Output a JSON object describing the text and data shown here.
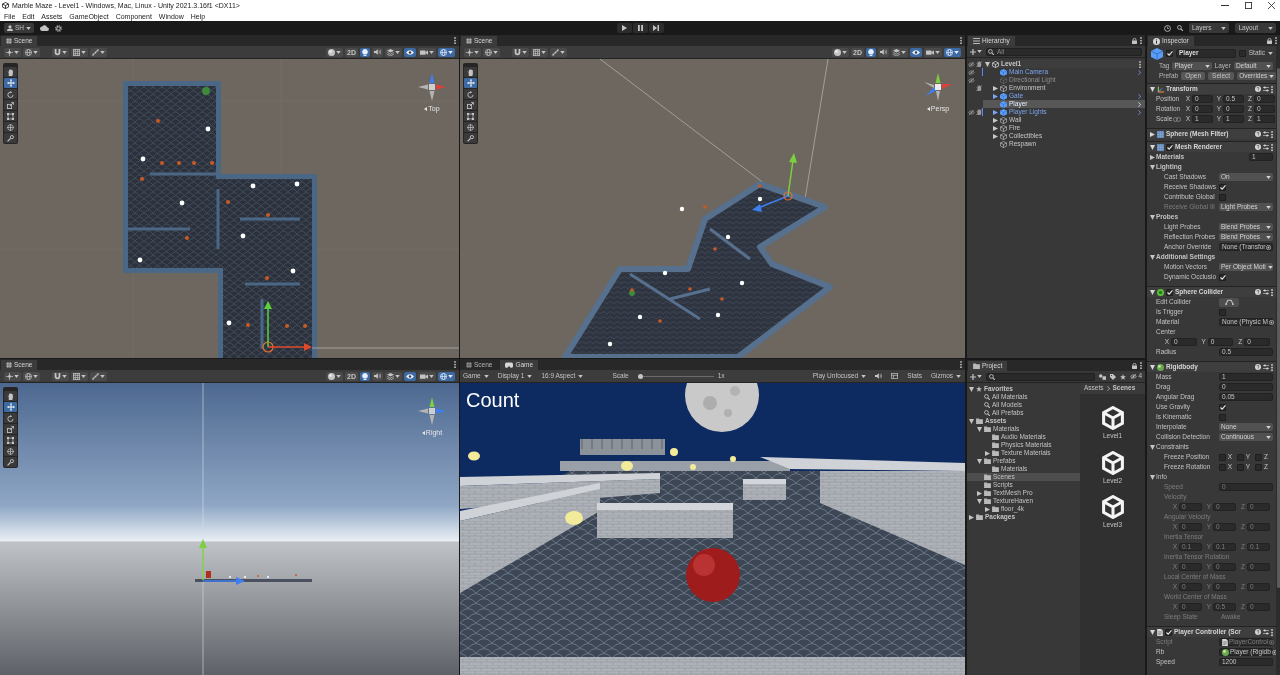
{
  "window": {
    "title": "Marble Maze - Level1 - Windows, Mac, Linux - Unity 2021.3.16f1 <DX11>"
  },
  "menu": [
    "File",
    "Edit",
    "Assets",
    "GameObject",
    "Component",
    "Window",
    "Help"
  ],
  "toolbar": {
    "account": "SH",
    "playing": false,
    "paused": false,
    "layers": "Layers",
    "layout": "Layout"
  },
  "scene_views": [
    {
      "kind": "top",
      "tabs": [
        {
          "label": "Scene",
          "kind": "scene",
          "selected": true
        }
      ],
      "tools": [
        {
          "kind": "hand",
          "selected": false
        },
        {
          "kind": "move",
          "selected": true
        },
        {
          "kind": "rotate",
          "selected": false
        },
        {
          "kind": "scale",
          "selected": false
        },
        {
          "kind": "rect",
          "selected": false
        },
        {
          "kind": "transform",
          "selected": false
        },
        {
          "kind": "custom",
          "selected": false
        }
      ],
      "two_d": {
        "label": "2D",
        "on": false
      },
      "lighting": true,
      "scene_visibility": true,
      "gizmos": true,
      "view_label": "Top"
    },
    {
      "kind": "perspective",
      "tabs": [
        {
          "label": "Scene",
          "kind": "scene",
          "selected": true
        }
      ],
      "tools": [
        {
          "kind": "hand",
          "selected": false
        },
        {
          "kind": "move",
          "selected": true
        },
        {
          "kind": "rotate",
          "selected": false
        },
        {
          "kind": "scale",
          "selected": false
        },
        {
          "kind": "rect",
          "selected": false
        },
        {
          "kind": "transform",
          "selected": false
        },
        {
          "kind": "custom",
          "selected": false
        }
      ],
      "two_d": {
        "label": "2D",
        "on": false
      },
      "lighting": true,
      "scene_visibility": true,
      "gizmos": true,
      "view_label": "Persp"
    },
    {
      "kind": "right",
      "tabs": [
        {
          "label": "Scene",
          "kind": "scene",
          "selected": true
        }
      ],
      "tools": [
        {
          "kind": "hand",
          "selected": false
        },
        {
          "kind": "move",
          "selected": true
        },
        {
          "kind": "rotate",
          "selected": false
        },
        {
          "kind": "scale",
          "selected": false
        },
        {
          "kind": "rect",
          "selected": false
        },
        {
          "kind": "transform",
          "selected": false
        },
        {
          "kind": "custom",
          "selected": false
        }
      ],
      "two_d": {
        "label": "2D",
        "on": false
      },
      "lighting": true,
      "scene_visibility": true,
      "gizmos": true,
      "view_label": "Right"
    }
  ],
  "game_panel": {
    "tabs": [
      {
        "label": "Scene",
        "kind": "scene",
        "selected": false
      },
      {
        "label": "Game",
        "kind": "game",
        "selected": true
      }
    ],
    "mode": "Game",
    "display": "Display 1",
    "aspect": "16:9 Aspect",
    "scale": {
      "label": "Scale",
      "level": 0,
      "reading": "1x"
    },
    "play_mode": "Play Unfocused",
    "muted": false,
    "stats": "Stats",
    "gizmos": "Gizmos",
    "hud_text": "Count"
  },
  "hierarchy": {
    "tabs": [
      {
        "label": "Hierarchy",
        "kind": "hierarchy",
        "selected": true
      }
    ],
    "search_placeholder": "All",
    "items": [
      {
        "label": "Level1",
        "kind": "scene",
        "expanded": true,
        "selected": false,
        "disabled": false,
        "hidden": true,
        "unpickable": true,
        "overridden": false,
        "children": [
          {
            "label": "Main Camera",
            "kind": "prefab",
            "selected": false,
            "disabled": false,
            "hidden": true,
            "unpickable": false,
            "overridden": true
          },
          {
            "label": "Directional Light",
            "kind": "object",
            "selected": false,
            "disabled": true,
            "hidden": true,
            "unpickable": false,
            "overridden": false
          },
          {
            "label": "Environment",
            "kind": "object",
            "expanded": false,
            "selected": false,
            "disabled": false,
            "hidden": false,
            "unpickable": true,
            "overridden": false
          },
          {
            "label": "Gate",
            "kind": "prefab",
            "expanded": false,
            "selected": false,
            "disabled": false,
            "hidden": false,
            "unpickable": false,
            "overridden": false
          },
          {
            "label": "Player",
            "kind": "prefab",
            "selected": true,
            "disabled": false,
            "hidden": false,
            "unpickable": false,
            "overridden": false
          },
          {
            "label": "Player Lights",
            "kind": "prefab",
            "expanded": false,
            "selected": false,
            "disabled": false,
            "hidden": true,
            "unpickable": true,
            "overridden": true
          },
          {
            "label": "Wall",
            "kind": "object",
            "expanded": false,
            "selected": false,
            "disabled": false,
            "hidden": false,
            "unpickable": false,
            "overridden": false
          },
          {
            "label": "Fire",
            "kind": "object",
            "expanded": false,
            "selected": false,
            "disabled": false,
            "hidden": false,
            "unpickable": false,
            "overridden": false
          },
          {
            "label": "Collectibles",
            "kind": "object",
            "expanded": false,
            "selected": false,
            "disabled": false,
            "hidden": false,
            "unpickable": false,
            "overridden": false
          },
          {
            "label": "Respawn",
            "kind": "object",
            "selected": false,
            "disabled": false,
            "hidden": false,
            "unpickable": false,
            "overridden": false
          }
        ]
      }
    ]
  },
  "project": {
    "tabs": [
      {
        "label": "Project",
        "kind": "project",
        "selected": true
      }
    ],
    "hidden_packages": "4",
    "tree": [
      {
        "label": "Favorites",
        "kind": "favorites",
        "expanded": true,
        "selected": false,
        "children": [
          {
            "label": "All Materials",
            "kind": "search",
            "selected": false
          },
          {
            "label": "All Models",
            "kind": "search",
            "selected": false
          },
          {
            "label": "All Prefabs",
            "kind": "search",
            "selected": false
          }
        ]
      },
      {
        "label": "Assets",
        "kind": "folder",
        "expanded": true,
        "selected": false,
        "children": [
          {
            "label": "Materials",
            "kind": "folder",
            "expanded": true,
            "selected": false,
            "children": [
              {
                "label": "Audio Materials",
                "kind": "folder",
                "selected": false
              },
              {
                "label": "Physics Materials",
                "kind": "folder",
                "selected": false
              },
              {
                "label": "Texture Materials",
                "kind": "folder",
                "expanded": false,
                "selected": false
              }
            ]
          },
          {
            "label": "Prefabs",
            "kind": "folder",
            "expanded": true,
            "selected": false,
            "children": [
              {
                "label": "Materials",
                "kind": "folder",
                "selected": false
              }
            ]
          },
          {
            "label": "Scenes",
            "kind": "folder",
            "selected": true
          },
          {
            "label": "Scripts",
            "kind": "folder",
            "selected": false
          },
          {
            "label": "TextMesh Pro",
            "kind": "folder",
            "expanded": false,
            "selected": false
          },
          {
            "label": "TextureHaven",
            "kind": "folder",
            "expanded": true,
            "selected": false,
            "children": [
              {
                "label": "floor_4k",
                "kind": "folder",
                "expanded": false,
                "selected": false
              }
            ]
          }
        ]
      },
      {
        "label": "Packages",
        "kind": "folder",
        "expanded": false,
        "selected": false
      }
    ],
    "breadcrumb": [
      "Assets",
      "Scenes"
    ],
    "assets": [
      {
        "label": "Level1",
        "kind": "scene"
      },
      {
        "label": "Level2",
        "kind": "scene"
      },
      {
        "label": "Level3",
        "kind": "scene"
      }
    ]
  },
  "inspector": {
    "tabs": [
      {
        "label": "Inspector",
        "kind": "inspector",
        "selected": true
      }
    ],
    "object": {
      "name": "Player",
      "active": true,
      "static_label": "Static",
      "static": false,
      "tag_label": "Tag",
      "tag": "Player",
      "layer_label": "Layer",
      "layer": "Default",
      "prefab_label": "Prefab",
      "prefab_buttons": [
        "Open",
        "Select"
      ],
      "overrides": "Overrides"
    },
    "components": [
      {
        "name": "Transform",
        "kind": "transform",
        "expanded": true,
        "rows": [
          {
            "kind": "vector",
            "label": "Position",
            "values": [
              {
                "axis": "X",
                "value": "0"
              },
              {
                "axis": "Y",
                "value": "0.5"
              },
              {
                "axis": "Z",
                "value": "0"
              }
            ]
          },
          {
            "kind": "vector",
            "label": "Rotation",
            "values": [
              {
                "axis": "X",
                "value": "0"
              },
              {
                "axis": "Y",
                "value": "0"
              },
              {
                "axis": "Z",
                "value": "0"
              }
            ]
          },
          {
            "kind": "vector",
            "label": "Scale",
            "linked": false,
            "values": [
              {
                "axis": "X",
                "value": "1"
              },
              {
                "axis": "Y",
                "value": "1"
              },
              {
                "axis": "Z",
                "value": "1"
              }
            ]
          }
        ]
      },
      {
        "name": "Sphere (Mesh Filter)",
        "kind": "mesh_filter",
        "expanded": false
      },
      {
        "name": "Mesh Renderer",
        "kind": "mesh_renderer",
        "enabled": true,
        "expanded": true,
        "rows": [
          {
            "kind": "section",
            "label": "Materials",
            "expanded": false,
            "count": "1"
          },
          {
            "kind": "section",
            "label": "Lighting",
            "expanded": true,
            "rows": [
              {
                "kind": "dropdown",
                "label": "Cast Shadows",
                "value": "On",
                "disabled": false
              },
              {
                "kind": "checkbox",
                "label": "Receive Shadows",
                "checked": true,
                "disabled": false
              },
              {
                "kind": "checkbox",
                "label": "Contribute Global",
                "checked": false,
                "disabled": false
              },
              {
                "kind": "dropdown",
                "label": "Receive Global Ill",
                "value": "Light Probes",
                "disabled": true
              }
            ]
          },
          {
            "kind": "section",
            "label": "Probes",
            "expanded": true,
            "rows": [
              {
                "kind": "dropdown",
                "label": "Light Probes",
                "value": "Blend Probes"
              },
              {
                "kind": "dropdown",
                "label": "Reflection Probes",
                "value": "Blend Probes"
              },
              {
                "kind": "object",
                "label": "Anchor Override",
                "value": "None (Transfor"
              }
            ]
          },
          {
            "kind": "section",
            "label": "Additional Settings",
            "expanded": true,
            "rows": [
              {
                "kind": "dropdown",
                "label": "Motion Vectors",
                "value": "Per Object Moti"
              },
              {
                "kind": "checkbox",
                "label": "Dynamic Occlusio",
                "checked": true
              }
            ]
          }
        ]
      },
      {
        "name": "Sphere Collider",
        "kind": "sphere_collider",
        "enabled": true,
        "expanded": true,
        "rows": [
          {
            "kind": "edit_button",
            "label": "Edit Collider"
          },
          {
            "kind": "checkbox",
            "label": "Is Trigger",
            "checked": false
          },
          {
            "kind": "object",
            "label": "Material",
            "value": "None (Physic M"
          },
          {
            "kind": "vector_block",
            "label": "Center",
            "values": [
              {
                "axis": "X",
                "value": "0"
              },
              {
                "axis": "Y",
                "value": "0"
              },
              {
                "axis": "Z",
                "value": "0"
              }
            ]
          },
          {
            "kind": "field",
            "label": "Radius",
            "value": "0.5"
          }
        ]
      },
      {
        "name": "Rigidbody",
        "kind": "rigidbody",
        "expanded": true,
        "rows": [
          {
            "kind": "field",
            "label": "Mass",
            "value": "1"
          },
          {
            "kind": "field",
            "label": "Drag",
            "value": "0"
          },
          {
            "kind": "field",
            "label": "Angular Drag",
            "value": "0.05"
          },
          {
            "kind": "checkbox",
            "label": "Use Gravity",
            "checked": true
          },
          {
            "kind": "checkbox",
            "label": "Is Kinematic",
            "checked": false
          },
          {
            "kind": "dropdown",
            "label": "Interpolate",
            "value": "None"
          },
          {
            "kind": "dropdown",
            "label": "Collision Detection",
            "value": "Continuous"
          },
          {
            "kind": "foldout",
            "label": "Constraints",
            "expanded": true,
            "rows": [
              {
                "kind": "constraint",
                "label": "Freeze Position",
                "values": [
                  {
                    "axis": "X",
                    "checked": false
                  },
                  {
                    "axis": "Y",
                    "checked": false
                  },
                  {
                    "axis": "Z",
                    "checked": false
                  }
                ]
              },
              {
                "kind": "constraint",
                "label": "Freeze Rotation",
                "values": [
                  {
                    "axis": "X",
                    "checked": false
                  },
                  {
                    "axis": "Y",
                    "checked": false
                  },
                  {
                    "axis": "Z",
                    "checked": false
                  }
                ]
              }
            ]
          },
          {
            "kind": "foldout",
            "label": "Info",
            "expanded": true,
            "disabled": true,
            "rows": [
              {
                "kind": "field",
                "label": "Speed",
                "value": "0"
              },
              {
                "kind": "vector_block",
                "label": "Velocity",
                "values": [
                  {
                    "axis": "X",
                    "value": "0"
                  },
                  {
                    "axis": "Y",
                    "value": "0"
                  },
                  {
                    "axis": "Z",
                    "value": "0"
                  }
                ]
              },
              {
                "kind": "vector_block",
                "label": "Angular Velocity",
                "values": [
                  {
                    "axis": "X",
                    "value": "0"
                  },
                  {
                    "axis": "Y",
                    "value": "0"
                  },
                  {
                    "axis": "Z",
                    "value": "0"
                  }
                ]
              },
              {
                "kind": "vector_block",
                "label": "Inertia Tensor",
                "values": [
                  {
                    "axis": "X",
                    "value": "0.1"
                  },
                  {
                    "axis": "Y",
                    "value": "0.1"
                  },
                  {
                    "axis": "Z",
                    "value": "0.1"
                  }
                ]
              },
              {
                "kind": "vector_block",
                "label": "Inertia Tensor Rotation",
                "values": [
                  {
                    "axis": "X",
                    "value": "0"
                  },
                  {
                    "axis": "Y",
                    "value": "0"
                  },
                  {
                    "axis": "Z",
                    "value": "0"
                  }
                ]
              },
              {
                "kind": "vector_block",
                "label": "Local Center of Mass",
                "values": [
                  {
                    "axis": "X",
                    "value": "0"
                  },
                  {
                    "axis": "Y",
                    "value": "0"
                  },
                  {
                    "axis": "Z",
                    "value": "0"
                  }
                ]
              },
              {
                "kind": "vector_block",
                "label": "World Center of Mass",
                "values": [
                  {
                    "axis": "X",
                    "value": "0"
                  },
                  {
                    "axis": "Y",
                    "value": "0.5"
                  },
                  {
                    "axis": "Z",
                    "value": "0"
                  }
                ]
              },
              {
                "kind": "text",
                "label": "Sleep State",
                "value": "Awake"
              }
            ]
          }
        ]
      },
      {
        "name": "Player Controller (Scr",
        "kind": "script",
        "enabled": true,
        "expanded": true,
        "rows": [
          {
            "kind": "object",
            "label": "Script",
            "value": "PlayerControl",
            "ref": {
              "kind": "script"
            },
            "disabled": true
          },
          {
            "kind": "object",
            "label": "Rb",
            "value": "Player (Rigidb",
            "ref": {
              "kind": "rigidbody"
            },
            "disabled": false
          },
          {
            "kind": "field",
            "label": "Speed",
            "value": "1200"
          }
        ]
      }
    ]
  }
}
